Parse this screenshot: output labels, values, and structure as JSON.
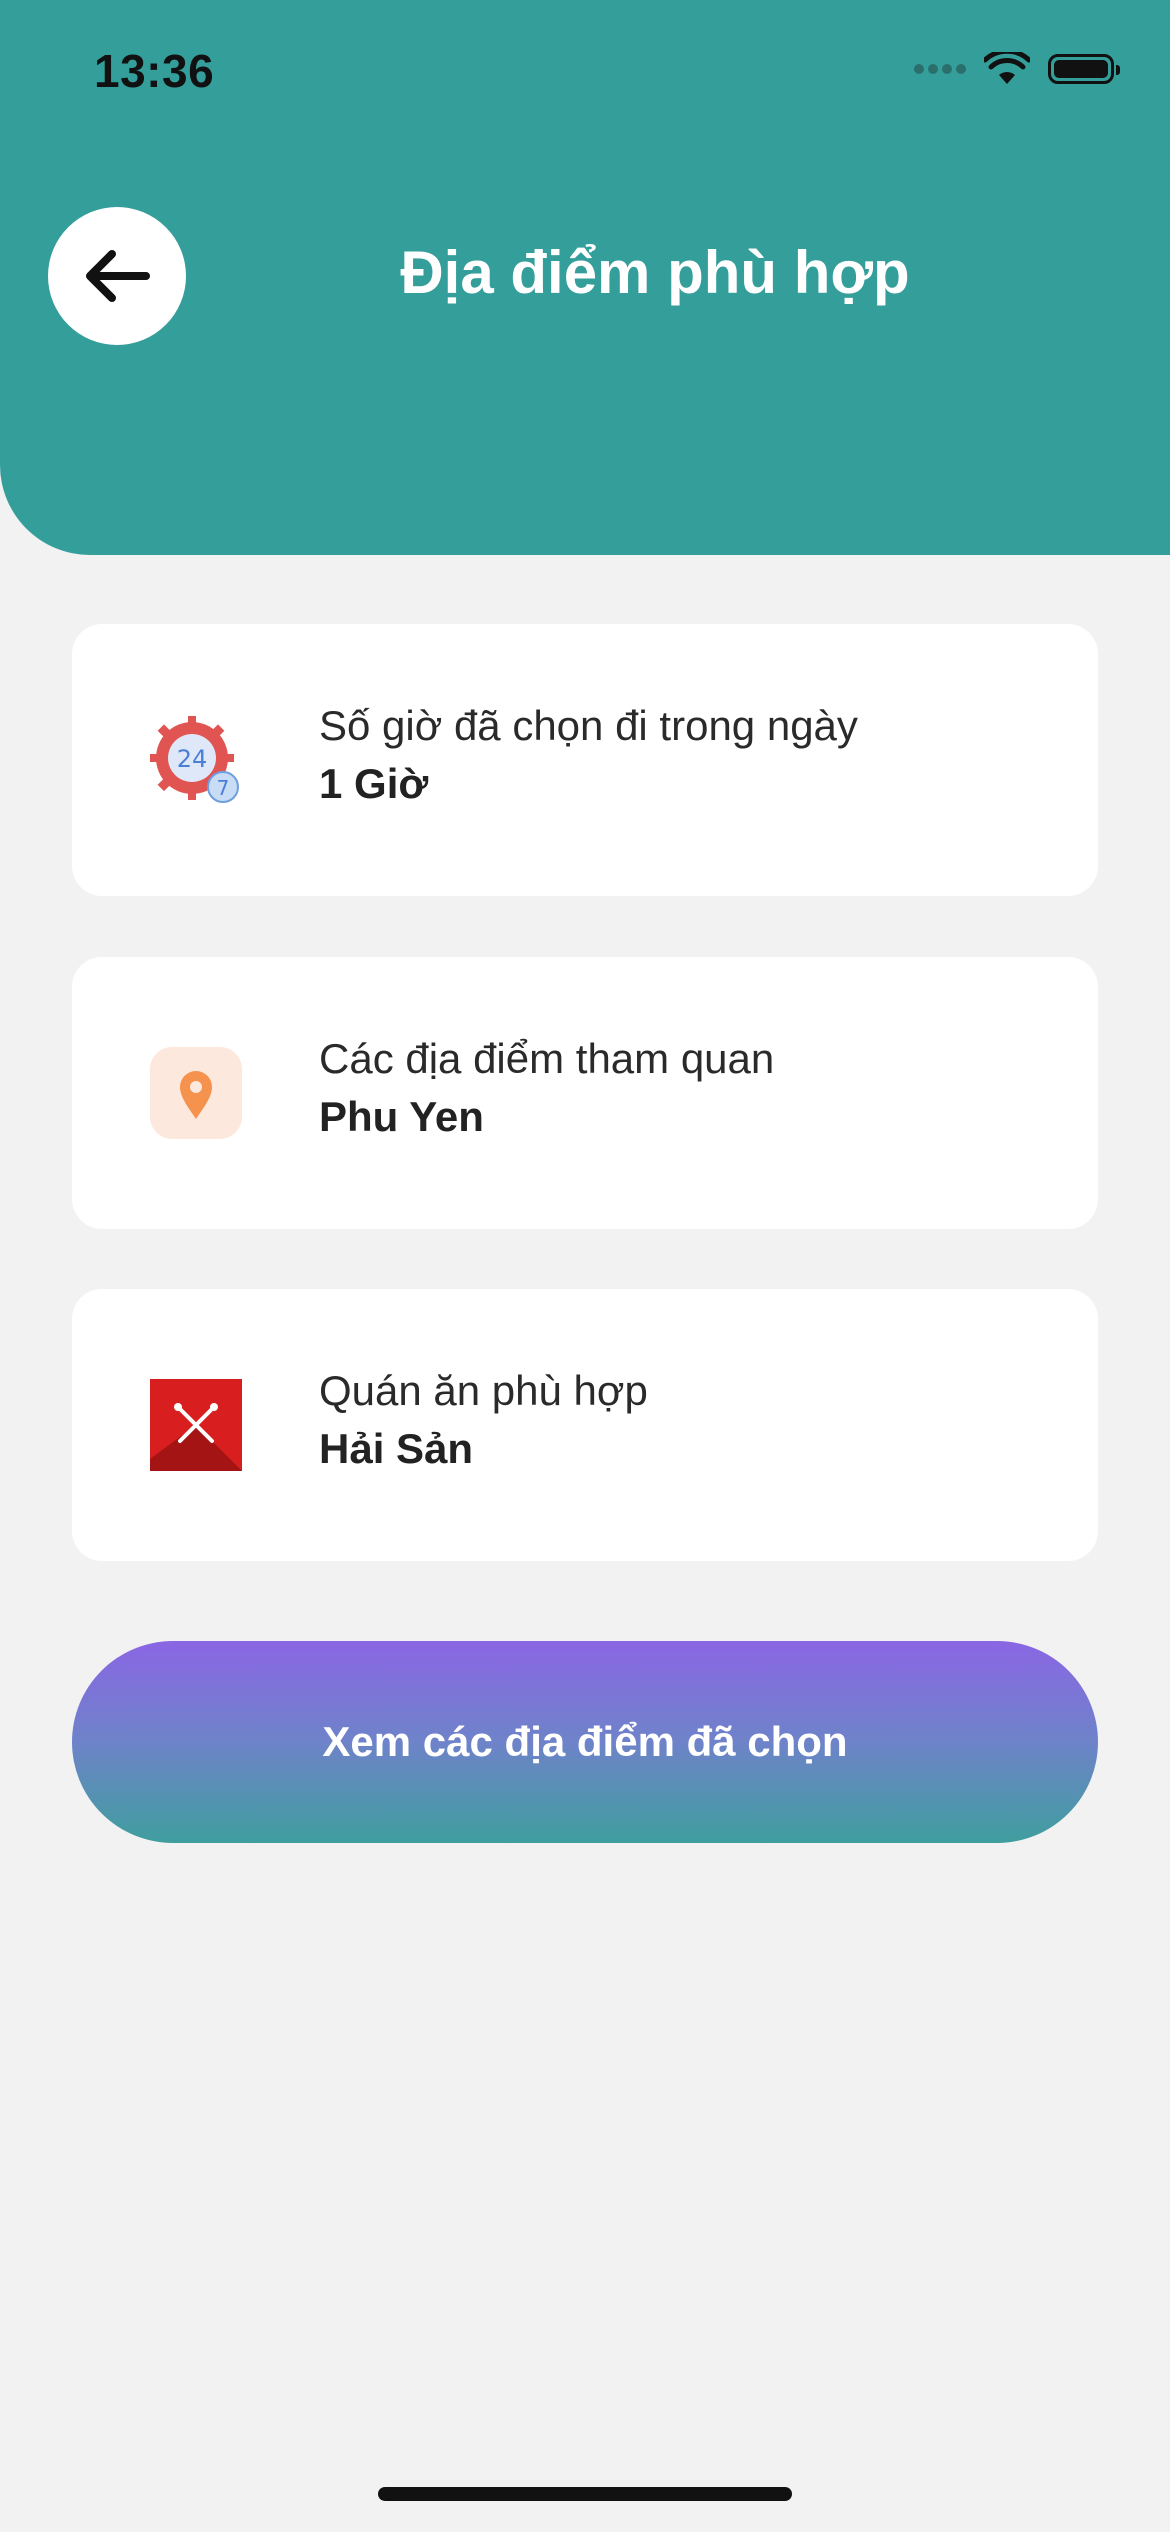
{
  "status_bar": {
    "time": "13:36"
  },
  "header": {
    "title": "Địa điểm phù hợp",
    "color": "#349e9b"
  },
  "cards": [
    {
      "label": "Số giờ đã chọn đi trong ngày",
      "value": "1 Giờ",
      "icon": "clock-24-7-icon"
    },
    {
      "label": "Các địa điểm tham quan",
      "value": "Phu Yen",
      "icon": "location-pin-icon"
    },
    {
      "label": "Quán ăn phù hợp",
      "value": "Hải Sản",
      "icon": "restaurant-icon"
    }
  ],
  "primary_button": {
    "label": "Xem các địa điểm đã chọn",
    "gradient": [
      "#8a66e4",
      "#3f9e9e"
    ]
  }
}
